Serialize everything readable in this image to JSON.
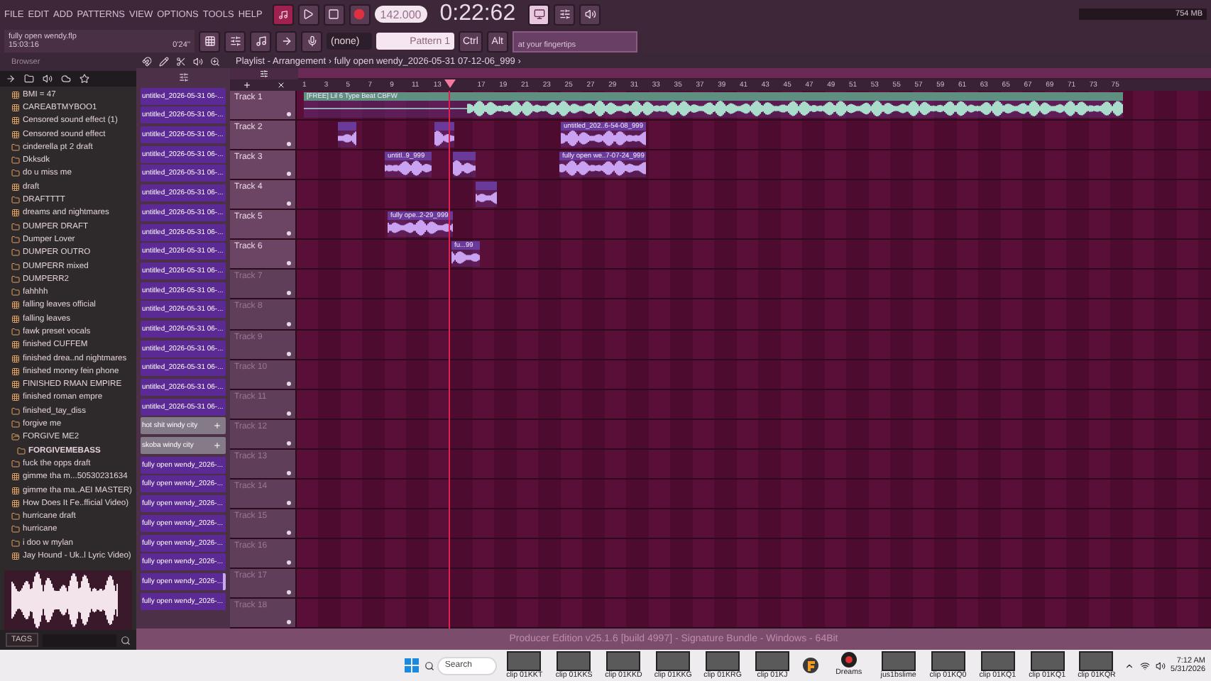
{
  "menu": [
    "FILE",
    "EDIT",
    "ADD",
    "PATTERNS",
    "VIEW",
    "OPTIONS",
    "TOOLS",
    "HELP"
  ],
  "transport": {
    "tempo": "142.000",
    "time": "0:22:62",
    "playing": false
  },
  "project": {
    "file": "fully open wendy.flp",
    "time": "15:03:16",
    "length": "0'24''"
  },
  "toolbar": {
    "pattern_selector": "(none)",
    "pattern": "Pattern 1",
    "keys": [
      "Ctrl",
      "Alt"
    ],
    "hint": "at your fingertips",
    "memory": "754 MB"
  },
  "browser": {
    "title": "Browser",
    "tags_button": "TAGS",
    "items": [
      {
        "name": "BMI = 47",
        "kind": "project"
      },
      {
        "name": "CAREABTMYBOO1",
        "kind": "project"
      },
      {
        "name": "Censored sound effect (1)",
        "kind": "project"
      },
      {
        "name": "Censored sound effect",
        "kind": "project"
      },
      {
        "name": "cinderella pt 2 draft",
        "kind": "folder",
        "expanded": false
      },
      {
        "name": "Dkksdk",
        "kind": "folder",
        "expanded": false
      },
      {
        "name": "do u miss me",
        "kind": "folder",
        "expanded": false
      },
      {
        "name": "draft",
        "kind": "project"
      },
      {
        "name": "DRAFTTTT",
        "kind": "folder",
        "expanded": false
      },
      {
        "name": "dreams and nightmares",
        "kind": "project"
      },
      {
        "name": "DUMPER DRAFT",
        "kind": "folder",
        "expanded": false
      },
      {
        "name": "Dumper Lover",
        "kind": "folder",
        "expanded": false
      },
      {
        "name": "DUMPER OUTRO",
        "kind": "folder",
        "expanded": false
      },
      {
        "name": "DUMPERR mixed",
        "kind": "folder",
        "expanded": false
      },
      {
        "name": "DUMPERR2",
        "kind": "folder",
        "expanded": false
      },
      {
        "name": "fahhhh",
        "kind": "folder",
        "expanded": false
      },
      {
        "name": "falling leaves official",
        "kind": "project"
      },
      {
        "name": "falling leaves",
        "kind": "project"
      },
      {
        "name": "fawk preset vocals",
        "kind": "folder",
        "expanded": false
      },
      {
        "name": "finished CUFFEM",
        "kind": "project"
      },
      {
        "name": "finished drea..nd nightmares",
        "kind": "project"
      },
      {
        "name": "finished money fein phone",
        "kind": "project"
      },
      {
        "name": "FINISHED RMAN EMPIRE",
        "kind": "project"
      },
      {
        "name": "finished roman empre",
        "kind": "project"
      },
      {
        "name": "finished_tay_diss",
        "kind": "folder",
        "expanded": false
      },
      {
        "name": "forgive me",
        "kind": "folder",
        "expanded": false
      },
      {
        "name": "FORGIVE ME2",
        "kind": "folder",
        "expanded": true,
        "children": [
          {
            "name": "FORGIVEMEBASS",
            "kind": "folder",
            "expanded": false
          }
        ]
      },
      {
        "name": "fuck the opps draft",
        "kind": "folder",
        "expanded": false
      },
      {
        "name": "gimme tha m...50530231634",
        "kind": "project"
      },
      {
        "name": "gimme tha ma..AEI MASTER)",
        "kind": "project"
      },
      {
        "name": "How Does It Fe..fficial Video)",
        "kind": "project"
      },
      {
        "name": "hurricane draft",
        "kind": "folder",
        "expanded": false
      },
      {
        "name": "hurricane",
        "kind": "folder",
        "expanded": false
      },
      {
        "name": "i doo w mylan",
        "kind": "folder",
        "expanded": false
      },
      {
        "name": "Jay Hound - Uk..l Lyric Video)",
        "kind": "project"
      }
    ]
  },
  "patterns": [
    {
      "name": "untitled_2026-05-31 06-...",
      "kind": "audio",
      "selected": false
    },
    {
      "name": "untitled_2026-05-31 06-...",
      "kind": "audio",
      "selected": false
    },
    {
      "name": "untitled_2026-05-31 06-...",
      "kind": "audio",
      "selected": false
    },
    {
      "name": "untitled_2026-05-31 06-...",
      "kind": "audio",
      "selected": false
    },
    {
      "name": "untitled_2026-05-31 06-...",
      "kind": "audio",
      "selected": false
    },
    {
      "name": "untitled_2026-05-31 06-...",
      "kind": "audio",
      "selected": false
    },
    {
      "name": "untitled_2026-05-31 06-...",
      "kind": "audio",
      "selected": false
    },
    {
      "name": "untitled_2026-05-31 06-...",
      "kind": "audio",
      "selected": false
    },
    {
      "name": "untitled_2026-05-31 06-...",
      "kind": "audio",
      "selected": false
    },
    {
      "name": "untitled_2026-05-31 06-...",
      "kind": "audio",
      "selected": false
    },
    {
      "name": "untitled_2026-05-31 06-...",
      "kind": "audio",
      "selected": false
    },
    {
      "name": "untitled_2026-05-31 06-...",
      "kind": "audio",
      "selected": false
    },
    {
      "name": "untitled_2026-05-31 06-...",
      "kind": "audio",
      "selected": false
    },
    {
      "name": "untitled_2026-05-31 06-...",
      "kind": "audio",
      "selected": false
    },
    {
      "name": "untitled_2026-05-31 06-...",
      "kind": "audio",
      "selected": false
    },
    {
      "name": "untitled_2026-05-31 06-...",
      "kind": "audio",
      "selected": false
    },
    {
      "name": "untitled_2026-05-31 06-...",
      "kind": "audio",
      "selected": false
    },
    {
      "name": "hot shit windy city",
      "kind": "pattern",
      "selected": false
    },
    {
      "name": "skoba windy city",
      "kind": "pattern",
      "selected": false
    },
    {
      "name": "fully open wendy_2026-...",
      "kind": "audio",
      "selected": false
    },
    {
      "name": "fully open wendy_2026-...",
      "kind": "audio",
      "selected": false
    },
    {
      "name": "fully open wendy_2026-...",
      "kind": "audio",
      "selected": false
    },
    {
      "name": "fully open wendy_2026-...",
      "kind": "audio",
      "selected": false
    },
    {
      "name": "fully open wendy_2026-...",
      "kind": "audio",
      "selected": false
    },
    {
      "name": "fully open wendy_2026-...",
      "kind": "audio",
      "selected": false
    },
    {
      "name": "fully open wendy_2026-...",
      "kind": "audio",
      "selected": true
    },
    {
      "name": "fully open wendy_2026-...",
      "kind": "audio",
      "selected": false
    }
  ],
  "playlist": {
    "title": "Playlist - Arrangement › fully open wendy_2026-05-31 07-12-06_999 ›",
    "ruler": [
      "1",
      "3",
      "5",
      "7",
      "9",
      "11",
      "13",
      "17",
      "19",
      "21",
      "23",
      "25",
      "27",
      "29",
      "31",
      "33",
      "35",
      "37",
      "39",
      "41",
      "43",
      "45",
      "47",
      "49",
      "51",
      "53",
      "55",
      "57",
      "59",
      "61",
      "63",
      "65",
      "67",
      "69",
      "71",
      "73",
      "75"
    ],
    "tracks": [
      {
        "name": "Track 1",
        "clips": [
          {
            "label": "[FREE] Lil 6 Type Beat CBFW",
            "color": "#5f8f80"
          }
        ]
      },
      {
        "name": "Track 2",
        "clips": [
          {
            "color": "#6a3a9a"
          },
          {
            "color": "#6a3a9a"
          },
          {
            "label": "untitled_202..6-54-08_999",
            "color": "#6a3a9a"
          }
        ]
      },
      {
        "name": "Track 3",
        "clips": [
          {
            "label": "untitl..9_999",
            "color": "#6a3a9a"
          },
          {
            "color": "#6a3a9a"
          },
          {
            "label": "fully open we..7-07-24_999",
            "color": "#6a3a9a"
          }
        ]
      },
      {
        "name": "Track 4",
        "clips": [
          {
            "color": "#6a3a9a"
          }
        ]
      },
      {
        "name": "Track 5",
        "clips": [
          {
            "label": "fully ope..2-29_999",
            "color": "#6a3a9a"
          }
        ]
      },
      {
        "name": "Track 6",
        "clips": [
          {
            "label": "fu...99",
            "color": "#6a3a9a"
          }
        ]
      },
      {
        "name": "Track 7"
      },
      {
        "name": "Track 8"
      },
      {
        "name": "Track 9"
      },
      {
        "name": "Track 10"
      },
      {
        "name": "Track 11"
      },
      {
        "name": "Track 12"
      },
      {
        "name": "Track 13"
      },
      {
        "name": "Track 14"
      },
      {
        "name": "Track 15"
      },
      {
        "name": "Track 16"
      },
      {
        "name": "Track 17"
      },
      {
        "name": "Track 18"
      }
    ]
  },
  "hint_bar": "Producer Edition v25.1.6 [build 4997] - Signature Bundle - Windows - 64Bit",
  "taskbar": {
    "search_placeholder": "Search",
    "apps": [
      {
        "label": "clip 01KKT",
        "kind": "video"
      },
      {
        "label": "clip 01KKS",
        "kind": "video"
      },
      {
        "label": "clip 01KKD",
        "kind": "video"
      },
      {
        "label": "clip 01KKG",
        "kind": "video"
      },
      {
        "label": "clip 01KRG",
        "kind": "video"
      },
      {
        "label": "clip 01KJ",
        "kind": "video"
      },
      {
        "kind": "daw"
      },
      {
        "label": "Dreams",
        "kind": "app"
      },
      {
        "label": "jus1bslime",
        "kind": "video"
      },
      {
        "label": "clip 01KQ0",
        "kind": "video"
      },
      {
        "label": "clip 01KQ1",
        "kind": "video"
      },
      {
        "label": "clip 01KQ1",
        "kind": "video"
      },
      {
        "label": "clip 01KQR",
        "kind": "video"
      }
    ],
    "time": "7:12 AM",
    "date": "5/31/2026"
  }
}
